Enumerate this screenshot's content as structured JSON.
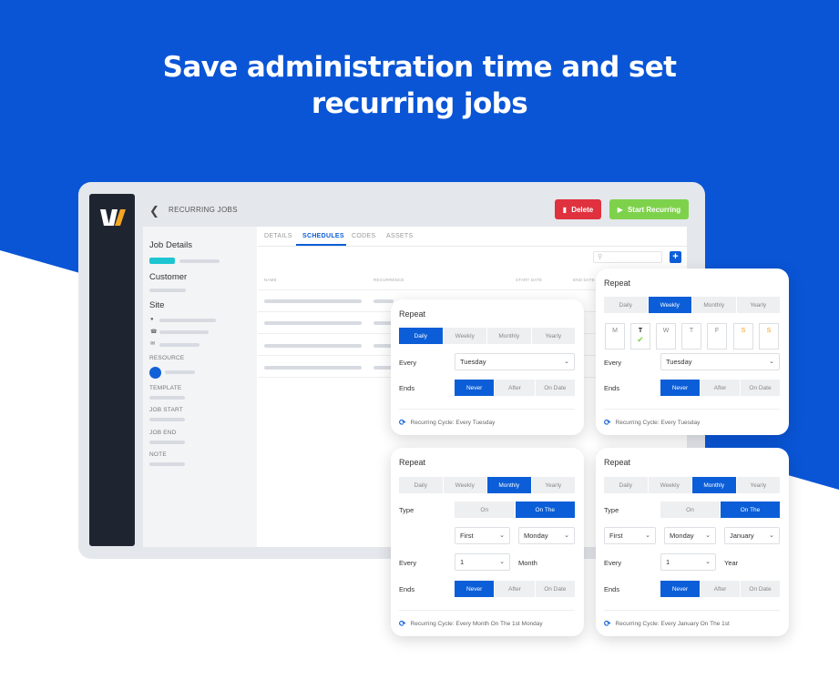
{
  "headline": {
    "line1": "Save administration time and set",
    "line2": "recurring jobs"
  },
  "colors": {
    "brand_blue": "#0b5ed7",
    "background_blue": "#0a55d6",
    "delete_red": "#e0313f",
    "start_green": "#7ed24b",
    "teal": "#1dc5d1"
  },
  "topbar": {
    "back_icon": "chevron-left-icon",
    "title": "RECURRING JOBS",
    "delete_label": "Delete",
    "start_label": "Start Recurring"
  },
  "left_panel": {
    "job_details": "Job Details",
    "customer": "Customer",
    "site": "Site",
    "resource": "RESOURCE",
    "template": "TEMPLATE",
    "job_start": "JOB START",
    "job_end": "JOB END",
    "note": "NOTE"
  },
  "tabs": [
    "DETAILS",
    "SCHEDULES",
    "CODES",
    "ASSETS"
  ],
  "active_tab": "SCHEDULES",
  "table": {
    "columns": [
      "NAME",
      "RECURRENCE",
      "START DATE",
      "END DATE"
    ]
  },
  "cards": {
    "daily": {
      "title": "Repeat",
      "frequency": [
        "Daily",
        "Weekly",
        "Monthly",
        "Yearly"
      ],
      "selected_frequency": "Daily",
      "every_label": "Every",
      "every_value": "Tuesday",
      "ends_label": "Ends",
      "ends_options": [
        "Never",
        "After",
        "On Date"
      ],
      "ends_selected": "Never",
      "footer": "Recurring Cycle: Every Tuesday"
    },
    "weekly": {
      "title": "Repeat",
      "frequency": [
        "Daily",
        "Weekly",
        "Monthly",
        "Yearly"
      ],
      "selected_frequency": "Weekly",
      "days": [
        "M",
        "T",
        "W",
        "T",
        "F",
        "S",
        "S"
      ],
      "selected_day_index": 1,
      "every_label": "Every",
      "every_value": "Tuesday",
      "ends_label": "Ends",
      "ends_options": [
        "Never",
        "After",
        "On Date"
      ],
      "ends_selected": "Never",
      "footer": "Recurring Cycle: Every Tuesday"
    },
    "monthly": {
      "title": "Repeat",
      "frequency": [
        "Daily",
        "Weekly",
        "Monthly",
        "Yearly"
      ],
      "selected_frequency": "Monthly",
      "type_label": "Type",
      "type_options": [
        "On",
        "On The"
      ],
      "type_selected": "On The",
      "ordinal": "First",
      "weekday": "Monday",
      "every_label": "Every",
      "every_value": "1",
      "every_unit": "Month",
      "ends_label": "Ends",
      "ends_options": [
        "Never",
        "After",
        "On Date"
      ],
      "ends_selected": "Never",
      "footer": "Recurring Cycle: Every Month On The 1st Monday"
    },
    "yearly": {
      "title": "Repeat",
      "frequency": [
        "Daily",
        "Weekly",
        "Monthly",
        "Yearly"
      ],
      "selected_frequency": "Monthly",
      "type_label": "Type",
      "type_options": [
        "On",
        "On The"
      ],
      "type_selected": "On The",
      "ordinal": "First",
      "weekday": "Monday",
      "month": "January",
      "every_label": "Every",
      "every_value": "1",
      "every_unit": "Year",
      "ends_label": "Ends",
      "ends_options": [
        "Never",
        "After",
        "On Date"
      ],
      "ends_selected": "Never",
      "footer": "Recurring Cycle: Every January On The 1st"
    }
  }
}
